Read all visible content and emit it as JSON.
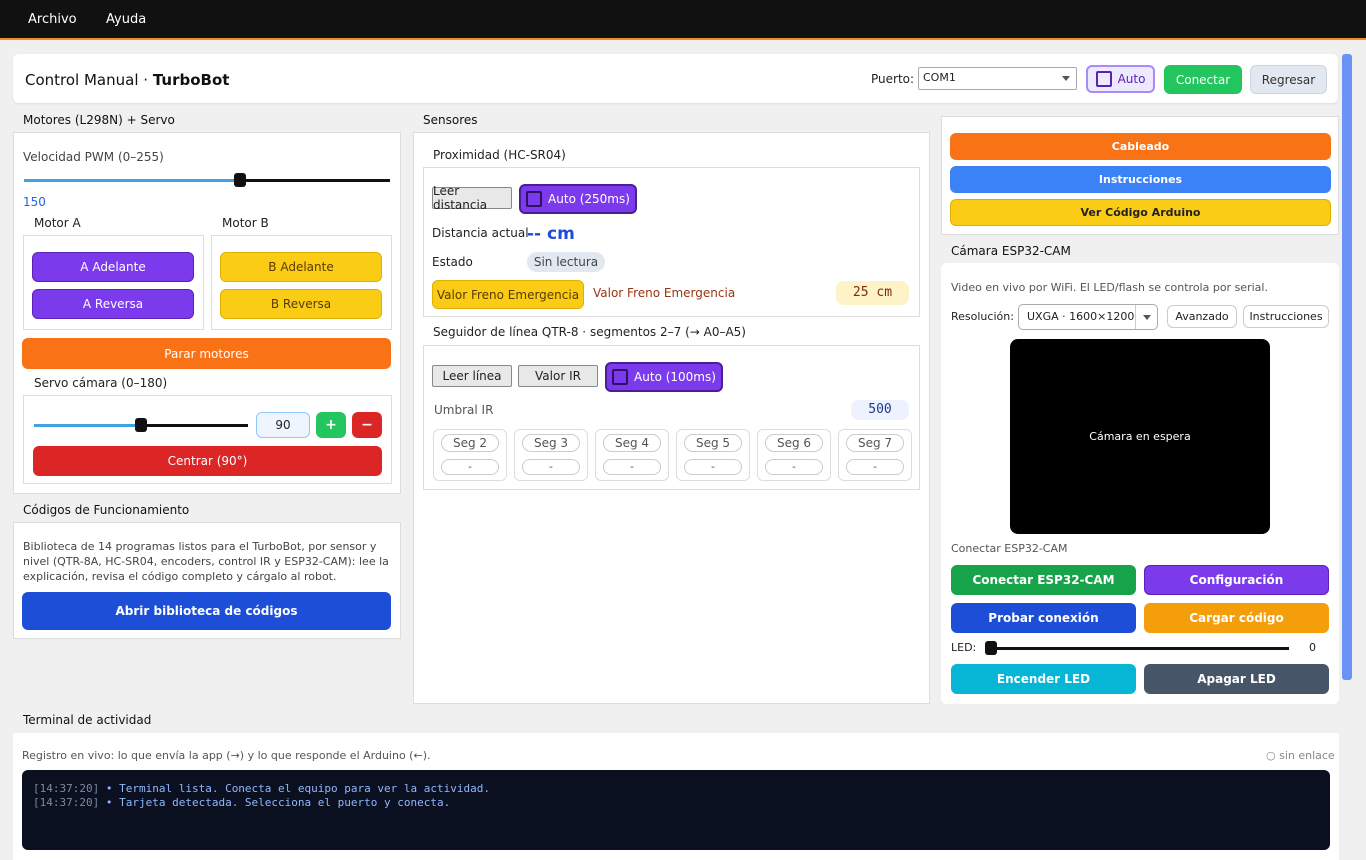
{
  "menu": {
    "file": "Archivo",
    "help": "Ayuda"
  },
  "header": {
    "title_prefix": "Control Manual · ",
    "title_bold": "TurboBot",
    "port_label": "Puerto:",
    "port_value": "COM1",
    "auto_label": "Auto",
    "connect": "Conectar",
    "back": "Regresar"
  },
  "motors": {
    "title": "Motores (L298N) + Servo",
    "pwm_label": "Velocidad PWM (0–255)",
    "pwm_value": "150",
    "pwm_fraction": 0.59,
    "motor_a": "Motor A",
    "motor_b": "Motor B",
    "a_fwd": "A Adelante",
    "a_rev": "A Reversa",
    "b_fwd": "B Adelante",
    "b_rev": "B Reversa",
    "stop": "Parar motores",
    "servo_label": "Servo cámara (0–180)",
    "servo_value": "90",
    "servo_fraction": 0.5,
    "plus": "+",
    "minus": "−",
    "center": "Centrar (90°)"
  },
  "codes": {
    "title": "Códigos de Funcionamiento",
    "desc": "Biblioteca de 14 programas listos para el TurboBot, por sensor y nivel (QTR-8A, HC-SR04, encoders, control IR y ESP32-CAM): lee la explicación, revisa el código completo y cárgalo al robot.",
    "open": "Abrir biblioteca de códigos"
  },
  "sensors": {
    "title": "Sensores",
    "prox_title": "Proximidad (HC-SR04)",
    "read_distance": "Leer distancia",
    "auto_250": "Auto (250ms)",
    "distance_label": "Distancia actual",
    "distance_value": "-- cm",
    "state_label": "Estado",
    "state_value": "Sin lectura",
    "brake_btn": "Valor Freno Emergencia",
    "brake_label": "Valor Freno Emergencia",
    "brake_value": "25 cm",
    "line_title": "Seguidor de línea QTR-8 · segmentos 2–7 (→ A0–A5)",
    "read_line": "Leer línea",
    "ir_value": "Valor IR",
    "auto_100": "Auto (100ms)",
    "threshold_label": "Umbral IR",
    "threshold_value": "500",
    "segments": [
      {
        "name": "Seg 2",
        "value": "-"
      },
      {
        "name": "Seg 3",
        "value": "-"
      },
      {
        "name": "Seg 4",
        "value": "-"
      },
      {
        "name": "Seg 5",
        "value": "-"
      },
      {
        "name": "Seg 6",
        "value": "-"
      },
      {
        "name": "Seg 7",
        "value": "-"
      }
    ]
  },
  "side": {
    "wiring": "Cableado",
    "instructions": "Instrucciones",
    "arduino_code": "Ver Código Arduino"
  },
  "cam": {
    "title": "Cámara ESP32-CAM",
    "desc": "Video en vivo por WiFi. El LED/flash se controla por serial.",
    "res_label": "Resolución:",
    "res_value": "UXGA · 1600×1200",
    "advanced": "Avanzado",
    "instructions": "Instrucciones",
    "standby": "Cámara en espera",
    "connect_label": "Conectar ESP32-CAM",
    "connect_btn": "Conectar ESP32-CAM",
    "config": "Configuración",
    "test": "Probar conexión",
    "load": "Cargar código",
    "led_label": "LED:",
    "led_value": "0",
    "led_fraction": 0,
    "led_on": "Encender LED",
    "led_off": "Apagar LED"
  },
  "terminal": {
    "title": "Terminal de actividad",
    "desc": "Registro en vivo: lo que envía la app (→) y lo que responde el Arduino (←).",
    "status": "○ sin enlace",
    "lines": [
      {
        "time": "[14:37:20]",
        "text": "• Terminal lista. Conecta el equipo para ver la actividad."
      },
      {
        "time": "[14:37:20]",
        "text": "• Tarjeta detectada. Selecciona el puerto y conecta."
      }
    ]
  }
}
